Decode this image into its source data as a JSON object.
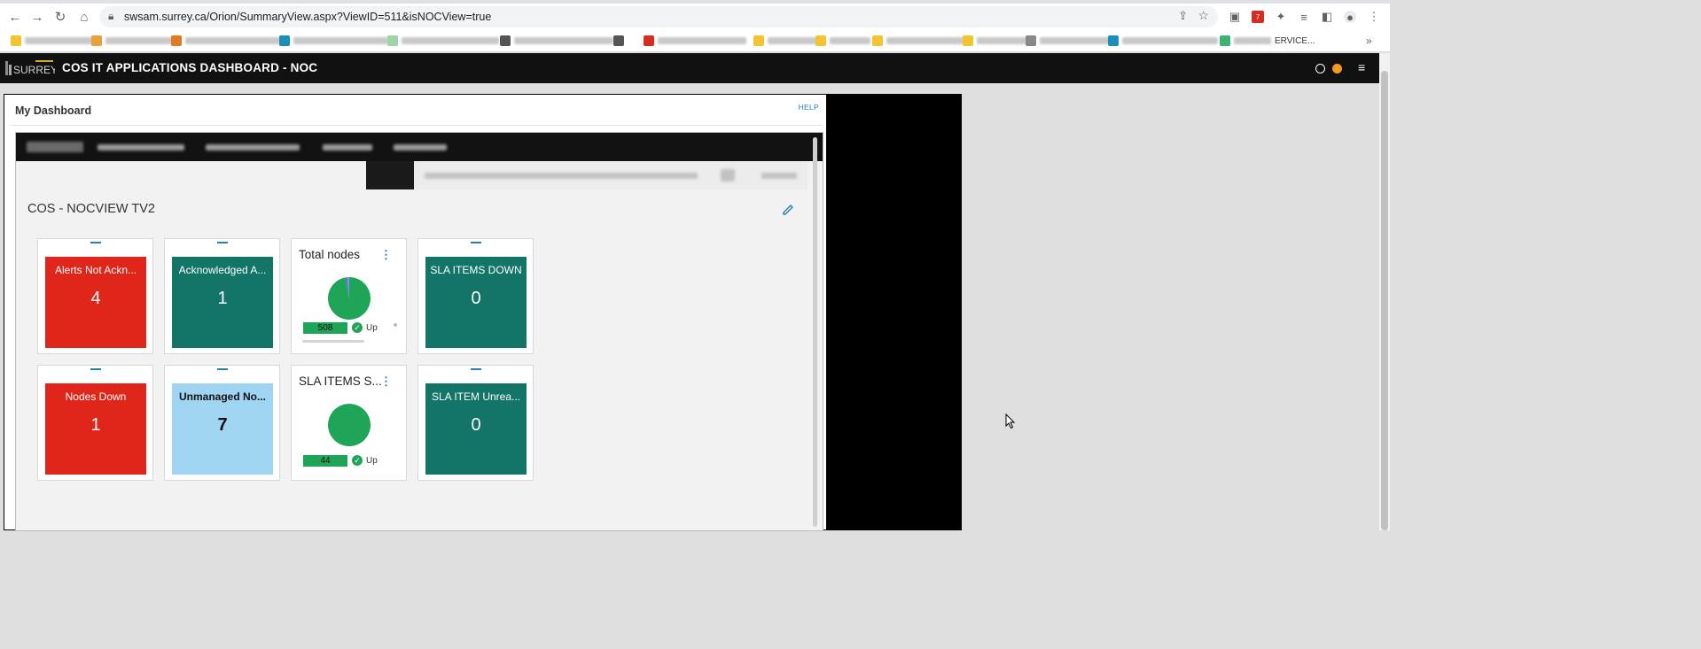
{
  "browser": {
    "url": "swsam.surrey.ca/Orion/SummaryView.aspx?ViewID=511&isNOCView=true",
    "bookmark_tail": "ERVICE..."
  },
  "app": {
    "title": "COS IT APPLICATIONS DASHBOARD - NOC",
    "menu_icon": "hamburger-icon"
  },
  "panel": {
    "title": "My Dashboard",
    "help": "HELP"
  },
  "dashboard": {
    "title": "COS - NOCVIEW TV2",
    "tiles": [
      {
        "label": "Alerts Not Ackn...",
        "value": "4",
        "color": "#e0261a"
      },
      {
        "label": "Acknowledged A...",
        "value": "1",
        "color": "#127567"
      },
      {
        "label": "Total nodes",
        "count": "508",
        "status": "Up",
        "up_fraction": 0.97,
        "color": "#1fa557"
      },
      {
        "label": "SLA ITEMS DOWN",
        "value": "0",
        "color": "#127567"
      },
      {
        "label": "Nodes Down",
        "value": "1",
        "color": "#e0261a"
      },
      {
        "label": "Unmanaged No...",
        "value": "7",
        "color": "#a0d4f3"
      },
      {
        "label": "SLA ITEMS S...",
        "count": "44",
        "status": "Up",
        "up_fraction": 1.0,
        "color": "#1fa557"
      },
      {
        "label": "SLA ITEM Unrea...",
        "value": "0",
        "color": "#127567"
      }
    ]
  }
}
